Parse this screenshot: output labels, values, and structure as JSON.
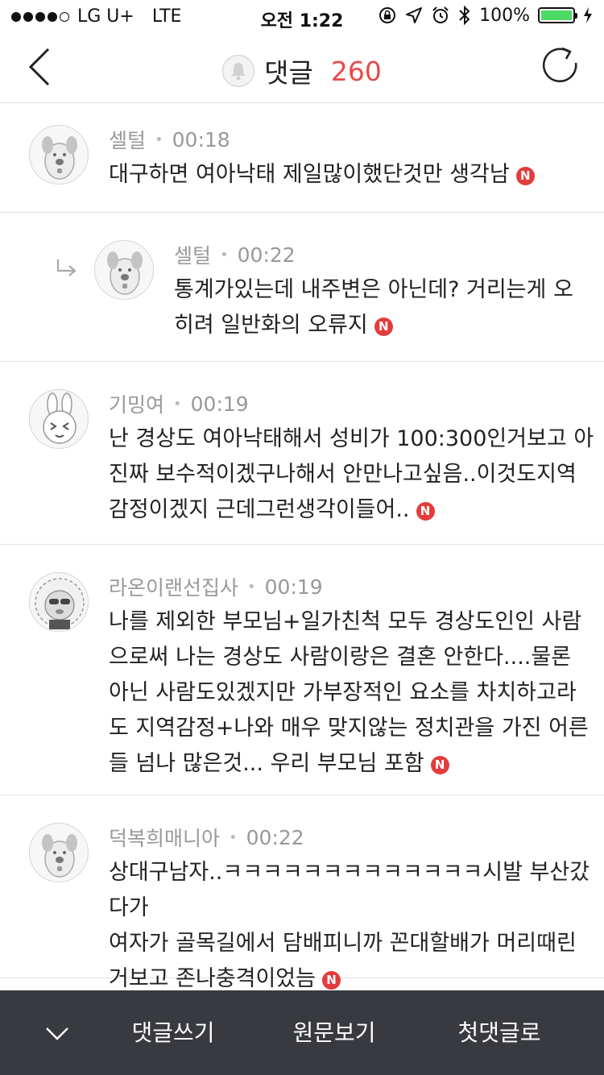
{
  "status": {
    "carrier": "LG U+",
    "network": "LTE",
    "time": "오전 1:22",
    "battery": "100%",
    "battery_level": 1.0,
    "battery_color": "#4cd964"
  },
  "header": {
    "title": "댓글",
    "count": "260",
    "accent": "#e84a4a"
  },
  "comments": [
    {
      "author": "셀털",
      "time": "00:18",
      "text": "대구하면 여아낙태 제일많이했단것만 생각남",
      "avatar": "dog-avatar",
      "reply": false
    },
    {
      "author": "셀털",
      "time": "00:22",
      "text": "통계가있는데 내주변은 아닌데? 거리는게 오\n히려 일반화의 오류지",
      "avatar": "dog-avatar",
      "reply": true
    },
    {
      "author": "기밍여",
      "time": "00:19",
      "text": "난 경상도 여아낙태해서 성비가 100:300인거보고 아\n진짜 보수적이겠구나해서 안만나고싶음..이것도지역\n감정이겠지 근데그런생각이들어..",
      "avatar": "rabbit-avatar",
      "reply": false
    },
    {
      "author": "라온이랜선집사",
      "time": "00:19",
      "text": "나를 제외한 부모님+일가친척 모두 경상도인인 사람\n으로써 나는 경상도 사람이랑은 결혼 안한다....물론\n아닌 사람도있겠지만 가부장적인 요소를 차치하고라\n도 지역감정+나와 매우 맞지않는 정치관을 가진 어른\n들 넘나 많은것... 우리 부모님 포함",
      "avatar": "lion-avatar",
      "reply": false
    },
    {
      "author": "덕복희매니아",
      "time": "00:22",
      "text": "상대구남자..ㅋㅋㅋㅋㅋㅋㅋㅋㅋㅋㅋㅋㅋ시발 부산갔다가\n여자가 골목길에서 담배피니까 꼰대할배가 머리때린\n거보고 존나충격이었늠",
      "avatar": "dog-avatar",
      "reply": false
    }
  ],
  "badge": {
    "label": "N",
    "color": "#e23c3c"
  },
  "bottom": {
    "collapse_icon": "chevron-down-icon",
    "write": "댓글쓰기",
    "original": "원문보기",
    "first": "첫댓글로",
    "background": "#383a3f"
  }
}
